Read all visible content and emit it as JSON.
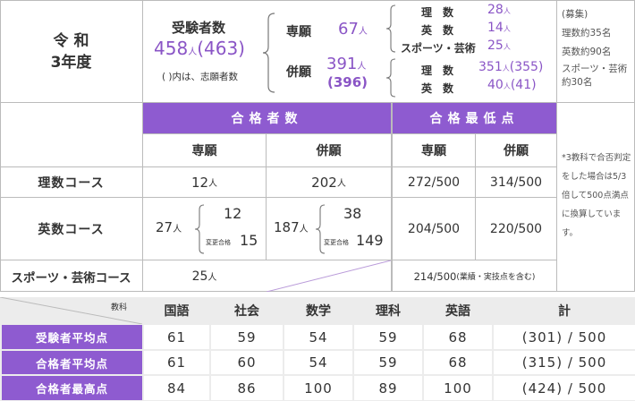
{
  "year": {
    "line1": "令 和",
    "line2": "3年度"
  },
  "applicants": {
    "label": "受験者数",
    "total": "458",
    "unit": "人",
    "total_paren": "(463)",
    "note": "(  )内は、志願者数",
    "senngan": {
      "label": "専願",
      "value": "67",
      "unit": "人"
    },
    "heigan": {
      "label": "併願",
      "value": "391",
      "unit": "人",
      "paren": "(396)"
    },
    "senngan_breakdown": [
      {
        "label": "理　数",
        "value": "28",
        "unit": "人"
      },
      {
        "label": "英　数",
        "value": "14",
        "unit": "人"
      },
      {
        "label": "スポーツ・芸術",
        "value": "25",
        "unit": "人"
      }
    ],
    "heigan_breakdown": [
      {
        "label": "理　数",
        "value": "351",
        "unit": "人",
        "paren": "(355)"
      },
      {
        "label": "英　数",
        "value": "40",
        "unit": "人",
        "paren": "(41)"
      }
    ]
  },
  "recruit": {
    "title": "(募集)",
    "lines": [
      "理数約35名",
      "英数約90名",
      "スポーツ・芸術",
      "約30名"
    ]
  },
  "headers": {
    "passers": "合格者数",
    "min_score": "合格最低点",
    "senngan": "専願",
    "heigan": "併願"
  },
  "courses": [
    {
      "name": "理数コース",
      "pass_s": "12",
      "pass_h": "202",
      "min_s": "272/500",
      "min_h": "314/500"
    },
    {
      "name": "英数コース",
      "pass_s_total": "27",
      "pass_s_a": "12",
      "pass_s_b": "15",
      "pass_h_total": "187",
      "pass_h_a": "38",
      "pass_h_b": "149",
      "change_label": "変更合格",
      "min_s": "204/500",
      "min_h": "220/500"
    },
    {
      "name": "スポーツ・芸術コース",
      "pass": "25",
      "min_note": "214/500",
      "min_note_suffix": "(業績・実技点を含む)"
    }
  ],
  "unit": "人",
  "side_note": "*3教科で合否判定をした場合は5/3倍して500点満点に換算しています。",
  "scores": {
    "corner": "教科",
    "subjects": [
      "国語",
      "社会",
      "数学",
      "理科",
      "英語",
      "計"
    ],
    "rows": [
      {
        "label": "受験者平均点",
        "values": [
          "61",
          "59",
          "54",
          "59",
          "68",
          "(301) / 500"
        ]
      },
      {
        "label": "合格者平均点",
        "values": [
          "61",
          "60",
          "54",
          "59",
          "68",
          "(315) / 500"
        ]
      },
      {
        "label": "合格者最高点",
        "values": [
          "84",
          "86",
          "100",
          "89",
          "100",
          "(424) / 500"
        ]
      }
    ]
  }
}
